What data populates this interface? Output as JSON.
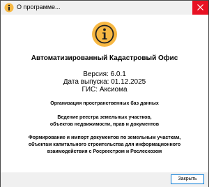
{
  "window": {
    "title": "О программе..."
  },
  "icons": {
    "app": "info-icon",
    "info": "info-icon",
    "close": "close-icon"
  },
  "colors": {
    "accent": "#f7b843",
    "close_button": "#e81123",
    "button_border": "#0078d7"
  },
  "about": {
    "product_name": "Автоматизированный Кадастровый Офис",
    "version": "Версия: 6.0.1",
    "release_date": "Дата выпуска: 01.12.2025",
    "gis": "ГИС: Аксиома",
    "features": [
      "Организация пространственных баз данных",
      "Ведение реестра земельных участков,",
      "объектов недвижимости, прав и документов",
      "Формирование и импорт документов по земельным участкам,",
      "объектам капитального строительства для информационного",
      "взаимодействия с Росреестром и Рослесхозом"
    ]
  },
  "footer": {
    "close_label": "Закрыть"
  }
}
